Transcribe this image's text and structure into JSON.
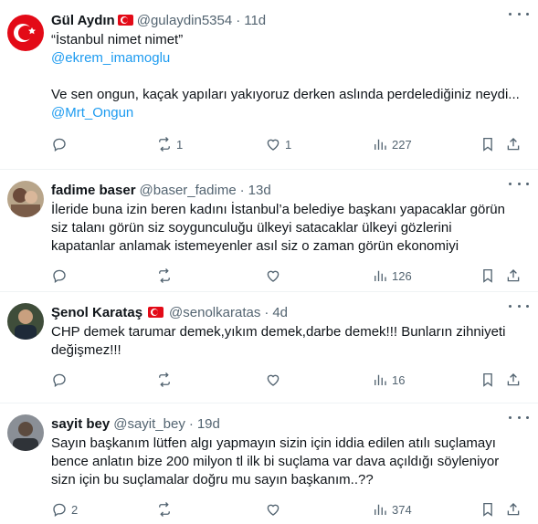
{
  "tweets": [
    {
      "name": "Gül Aydın",
      "handle": "@gulaydin5354",
      "separator": "·",
      "time": "11d",
      "has_flag": true,
      "lines": [
        "“İstanbul nimet nimet”",
        "@ekrem_imamoglu",
        "",
        "Ve sen ongun, kaçak yapıları yakıyoruz derken aslında perdelediğiniz neydi...",
        "@Mrt_Ongun"
      ],
      "link_lines": [
        1,
        4
      ],
      "replies": "",
      "reposts": "1",
      "likes": "1",
      "views": "227"
    },
    {
      "name": "fadime baser",
      "handle": "@baser_fadime",
      "separator": "·",
      "time": "13d",
      "has_flag": false,
      "lines": [
        "İleride buna izin beren kadını İstanbul’a belediye başkanı yapacaklar görün",
        "siz talanı görün siz soygunculuğu ülkeyi satacaklar ülkeyi gözlerini",
        "kapatanlar anlamak istemeyenler asıl siz o zaman görün ekonomiyi"
      ],
      "link_lines": [],
      "replies": "",
      "reposts": "",
      "likes": "",
      "views": "126"
    },
    {
      "name": "Şenol Karataş",
      "handle": "@senolkaratas",
      "separator": "·",
      "time": "4d",
      "has_flag": true,
      "lines": [
        "CHP demek tarumar demek,yıkım demek,darbe demek!!!  Bunların zihniyeti",
        "değişmez!!!"
      ],
      "link_lines": [],
      "replies": "",
      "reposts": "",
      "likes": "",
      "views": "16"
    },
    {
      "name": "sayit bey",
      "handle": "@sayit_bey",
      "separator": "·",
      "time": "19d",
      "has_flag": false,
      "lines": [
        "Sayın başkanım lütfen algı yapmayın sizin için iddia edilen atılı suçlamayı",
        "bence anlatın bize  200 milyon tl ilk bi suçlama var  dava açıldığı söyleniyor",
        "sizn için bu suçlamalar doğru mu sayın başkanım..??"
      ],
      "link_lines": [],
      "replies": "2",
      "reposts": "",
      "likes": "",
      "views": "374"
    }
  ],
  "colors": {
    "text": "#0f1419",
    "muted": "#536471",
    "link": "#1d9bf0",
    "border": "#eff3f4"
  },
  "icons": [
    "reply-icon",
    "repost-icon",
    "like-icon",
    "views-icon",
    "bookmark-icon",
    "share-icon",
    "more-icon"
  ]
}
